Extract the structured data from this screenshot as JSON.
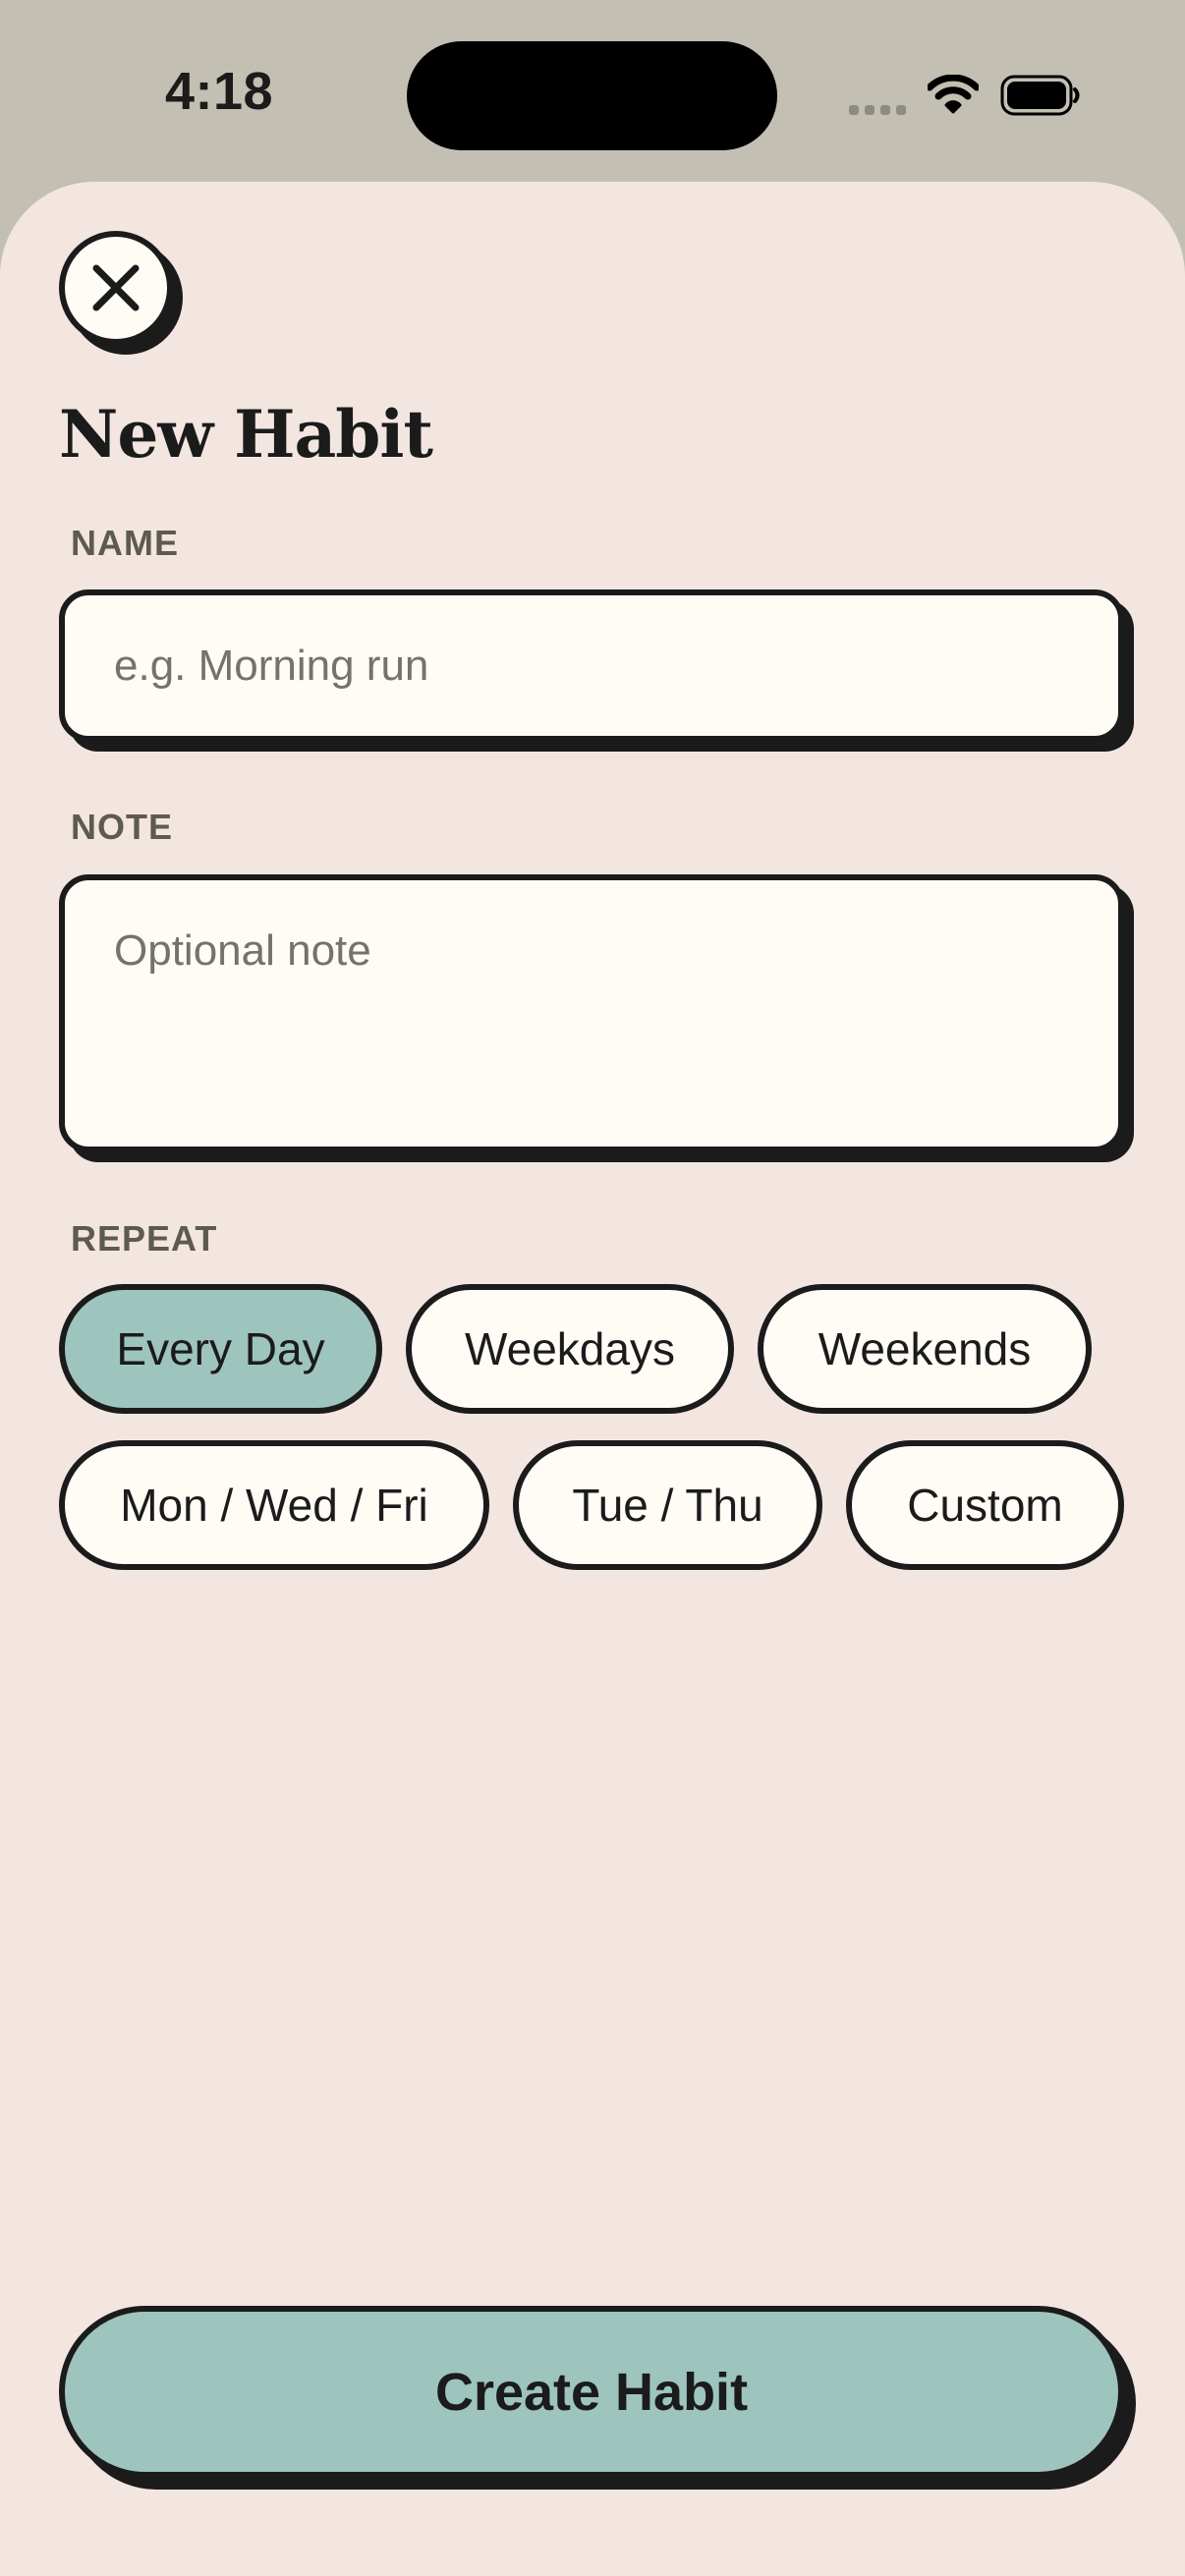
{
  "status_bar": {
    "time": "4:18",
    "icons": [
      "cellular-signal-icon",
      "wifi-icon",
      "battery-icon"
    ]
  },
  "sheet": {
    "close_icon": "close-icon",
    "title": "New Habit",
    "name": {
      "label": "NAME",
      "value": "",
      "placeholder": "e.g. Morning run"
    },
    "note": {
      "label": "NOTE",
      "value": "",
      "placeholder": "Optional note"
    },
    "repeat": {
      "label": "REPEAT",
      "options": [
        "Every Day",
        "Weekdays",
        "Weekends",
        "Mon / Wed / Fri",
        "Tue / Thu",
        "Custom"
      ],
      "selected": "Every Day"
    },
    "create_label": "Create Habit"
  },
  "colors": {
    "backdrop": "#c3bfb3",
    "sheet_background": "#f3e6e0",
    "accent": "#9ec4be",
    "field_background": "#fffcf6",
    "ink": "#1b1b1b",
    "label": "#5d5a52"
  }
}
